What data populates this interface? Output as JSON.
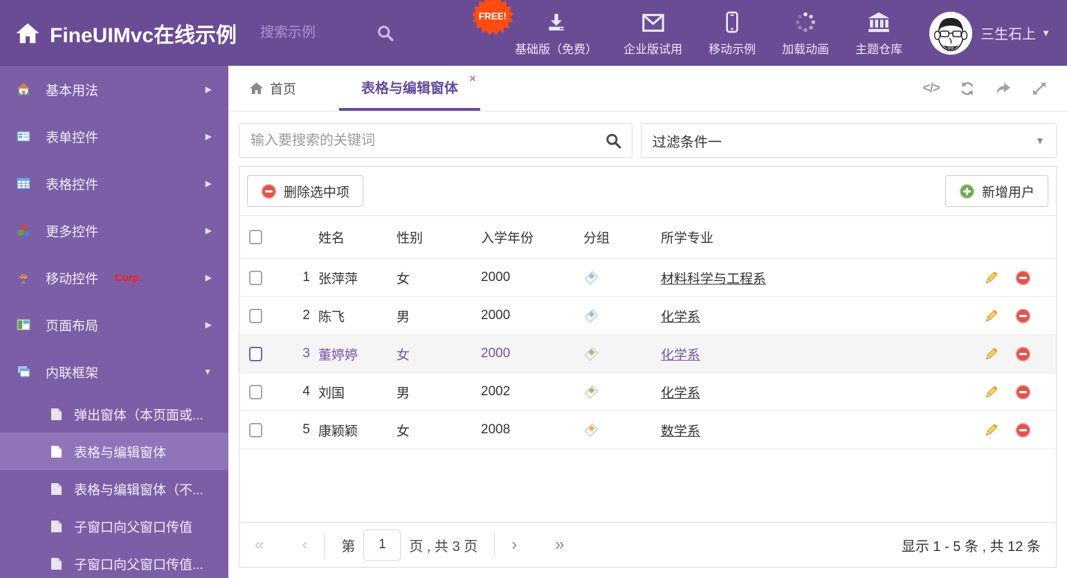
{
  "header": {
    "brand": "FineUIMvc在线示例",
    "search_placeholder": "搜索示例",
    "free_badge": "FREE!",
    "nav": [
      {
        "label": "基础版（免费）",
        "icon": "download-icon"
      },
      {
        "label": "企业版试用",
        "icon": "envelope-icon"
      },
      {
        "label": "移动示例",
        "icon": "mobile-icon"
      },
      {
        "label": "加载动画",
        "icon": "spinner-icon"
      },
      {
        "label": "主题仓库",
        "icon": "bank-icon"
      }
    ],
    "user": {
      "name": "三生石上"
    }
  },
  "sidebar": {
    "items": [
      {
        "label": "基本用法",
        "icon": "house-icon"
      },
      {
        "label": "表单控件",
        "icon": "form-icon"
      },
      {
        "label": "表格控件",
        "icon": "table-icon"
      },
      {
        "label": "更多控件",
        "icon": "cubes-icon"
      },
      {
        "label": "移动控件",
        "badge": "Corp.",
        "icon": "antenna-icon"
      },
      {
        "label": "页面布局",
        "icon": "layout-icon"
      },
      {
        "label": "内联框架",
        "icon": "frames-icon",
        "expanded": true
      }
    ],
    "subitems": [
      {
        "label": "弹出窗体（本页面或..."
      },
      {
        "label": "表格与编辑窗体",
        "active": true
      },
      {
        "label": "表格与编辑窗体（不..."
      },
      {
        "label": "子窗口向父窗口传值"
      },
      {
        "label": "子窗口向父窗口传值..."
      }
    ]
  },
  "tabs": {
    "home_label": "首页",
    "active_label": "表格与编辑窗体",
    "close_glyph": "×"
  },
  "filters": {
    "search_placeholder": "输入要搜索的关键词",
    "filter_value": "过滤条件一"
  },
  "toolbar": {
    "delete_label": "删除选中项",
    "add_label": "新增用户"
  },
  "table": {
    "columns": [
      "姓名",
      "性别",
      "入学年份",
      "分组",
      "所学专业"
    ],
    "rows": [
      {
        "num": "1",
        "name": "张萍萍",
        "gender": "女",
        "year": "2000",
        "tag": "#7EC2F3",
        "major": "材料科学与工程系"
      },
      {
        "num": "2",
        "name": "陈飞",
        "gender": "男",
        "year": "2000",
        "tag": "#7EC2F3",
        "major": "化学系"
      },
      {
        "num": "3",
        "name": "董婷婷",
        "gender": "女",
        "year": "2000",
        "tag": "#8CC45F",
        "major": "化学系",
        "selected": true
      },
      {
        "num": "4",
        "name": "刘国",
        "gender": "男",
        "year": "2002",
        "tag": "#8CC45F",
        "major": "化学系"
      },
      {
        "num": "5",
        "name": "康颖颖",
        "gender": "女",
        "year": "2008",
        "tag": "#F5A961",
        "major": "数学系"
      }
    ]
  },
  "pagination": {
    "first": "«",
    "prev": "‹",
    "next": "›",
    "last": "»",
    "page_prefix": "第",
    "page": "1",
    "page_suffix": "页 , 共 3 页",
    "summary": "显示 1 - 5 条 , 共 12 条"
  },
  "colors": {
    "header_bg": "#6A4C95",
    "sidebar_bg": "#7C5EA7",
    "accent": "#664A9B",
    "free_badge": "#FF4D12",
    "delete_red": "#E0534A",
    "add_green": "#67A94D"
  }
}
